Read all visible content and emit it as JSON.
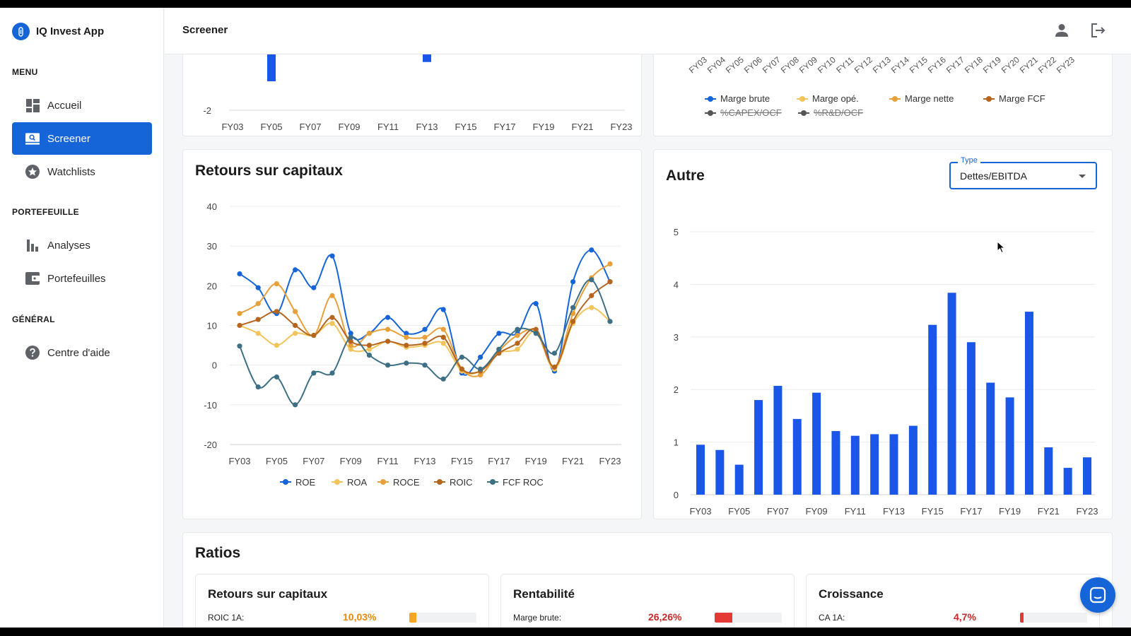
{
  "app": {
    "name": "IQ Invest App",
    "page_title": "Screener"
  },
  "sidebar": {
    "sections": [
      {
        "label": "MENU"
      },
      {
        "label": "PORTEFEUILLE"
      },
      {
        "label": "GÉNÉRAL"
      }
    ],
    "items": [
      {
        "label": "Accueil",
        "icon": "dashboard-icon"
      },
      {
        "label": "Screener",
        "icon": "screener-icon",
        "active": true
      },
      {
        "label": "Watchlists",
        "icon": "star-icon"
      },
      {
        "label": "Analyses",
        "icon": "bar-chart-icon"
      },
      {
        "label": "Portefeuilles",
        "icon": "wallet-icon"
      },
      {
        "label": "Centre d'aide",
        "icon": "help-icon"
      }
    ]
  },
  "cards": {
    "returns_title": "Retours sur capitaux",
    "other_title": "Autre",
    "ratios_title": "Ratios"
  },
  "type_select": {
    "label": "Type",
    "value": "Dettes/EBITDA"
  },
  "margins_legend": [
    {
      "name": "Marge brute",
      "color": "#1565d8",
      "hidden": false
    },
    {
      "name": "Marge opé.",
      "color": "#f2c45a",
      "hidden": false
    },
    {
      "name": "Marge nette",
      "color": "#e8a13a",
      "hidden": false
    },
    {
      "name": "Marge FCF",
      "color": "#b5651d",
      "hidden": false
    },
    {
      "name": "%CAPEX/OCF",
      "color": "#555555",
      "hidden": true
    },
    {
      "name": "%R&D/OCF",
      "color": "#555555",
      "hidden": true
    }
  ],
  "ratios": [
    {
      "title": "Retours sur capitaux",
      "label": "ROIC 1A:",
      "value": "10,03%",
      "value_color": "#e8890c",
      "fill": 0.1,
      "fill_color": "#f5a623"
    },
    {
      "title": "Rentabilité",
      "label": "Marge brute:",
      "value": "26,26%",
      "value_color": "#c62828",
      "fill": 0.26,
      "fill_color": "#e53935"
    },
    {
      "title": "Croissance",
      "label": "CA 1A:",
      "value": "4,7%",
      "value_color": "#c62828",
      "fill": 0.05,
      "fill_color": "#e53935"
    }
  ],
  "chart_data": [
    {
      "type": "bar",
      "title": "",
      "x": [
        "FY03",
        "FY04",
        "FY05",
        "FY06",
        "FY07",
        "FY08",
        "FY09",
        "FY10",
        "FY11",
        "FY12",
        "FY13",
        "FY14",
        "FY15",
        "FY16",
        "FY17",
        "FY18",
        "FY19",
        "FY20",
        "FY21",
        "FY22",
        "FY23"
      ],
      "x_tick_labels": [
        "FY03",
        "FY05",
        "FY07",
        "FY09",
        "FY11",
        "FY13",
        "FY15",
        "FY17",
        "FY19",
        "FY21",
        "FY23"
      ],
      "y_tick_labels": [
        "-2"
      ],
      "series": [
        {
          "values": [
            -0.2,
            -0.05,
            -1.1,
            -0.1,
            -0.1,
            0,
            0,
            0,
            0,
            0,
            -0.5,
            0,
            0,
            0,
            0,
            0,
            0,
            0,
            0,
            0,
            0
          ]
        }
      ]
    },
    {
      "type": "line",
      "title": "Retours sur capitaux",
      "x": [
        "FY03",
        "FY04",
        "FY05",
        "FY06",
        "FY07",
        "FY08",
        "FY09",
        "FY10",
        "FY11",
        "FY12",
        "FY13",
        "FY14",
        "FY15",
        "FY16",
        "FY17",
        "FY18",
        "FY19",
        "FY20",
        "FY21",
        "FY22",
        "FY23"
      ],
      "x_tick_labels": [
        "FY03",
        "FY05",
        "FY07",
        "FY09",
        "FY11",
        "FY13",
        "FY15",
        "FY17",
        "FY19",
        "FY21",
        "FY23"
      ],
      "ylim": [
        -20,
        40
      ],
      "y_ticks": [
        -20,
        -10,
        0,
        10,
        20,
        30,
        40
      ],
      "series": [
        {
          "name": "ROE",
          "color": "#1565d8",
          "values": [
            23,
            19.5,
            13,
            24,
            19.5,
            27.5,
            8,
            8,
            12,
            8,
            9,
            14,
            -2,
            2,
            8,
            8,
            15.5,
            -1.5,
            21,
            29,
            21
          ]
        },
        {
          "name": "ROA",
          "color": "#f2c45a",
          "values": [
            10,
            8,
            5,
            8,
            7.5,
            10.5,
            4,
            4,
            6,
            4.5,
            5,
            5.5,
            -1.5,
            -1.5,
            3,
            4,
            8.5,
            -1,
            10.5,
            14.5,
            11
          ]
        },
        {
          "name": "ROCE",
          "color": "#e8a13a",
          "values": [
            13,
            15.5,
            20.5,
            13.5,
            7.5,
            17.5,
            5,
            8,
            9,
            7,
            7,
            9,
            -1,
            -2.5,
            3.5,
            7.5,
            8.5,
            -0.5,
            13,
            22,
            25.5
          ]
        },
        {
          "name": "ROIC",
          "color": "#b5651d",
          "values": [
            10,
            11.5,
            13.5,
            10,
            7.5,
            12,
            6,
            5,
            6,
            5,
            5.5,
            7,
            -1,
            -1.5,
            3,
            5.5,
            9,
            -0.5,
            11,
            17.5,
            21
          ]
        },
        {
          "name": "FCF ROC",
          "color": "#3d6f85",
          "values": [
            4.8,
            -5.5,
            -3,
            -10,
            -2,
            -2,
            7,
            2.5,
            0,
            0.5,
            0,
            -3.5,
            2,
            -1,
            4,
            9,
            8,
            3,
            14.5,
            21.5,
            11
          ]
        }
      ]
    },
    {
      "type": "bar",
      "title": "Autre",
      "x": [
        "FY03",
        "FY04",
        "FY05",
        "FY06",
        "FY07",
        "FY08",
        "FY09",
        "FY10",
        "FY11",
        "FY12",
        "FY13",
        "FY14",
        "FY15",
        "FY16",
        "FY17",
        "FY18",
        "FY19",
        "FY20",
        "FY21",
        "FY22",
        "FY23"
      ],
      "x_tick_labels": [
        "FY03",
        "FY05",
        "FY07",
        "FY09",
        "FY11",
        "FY13",
        "FY15",
        "FY17",
        "FY19",
        "FY21",
        "FY23"
      ],
      "ylim": [
        0,
        5
      ],
      "y_ticks": [
        0,
        1,
        2,
        3,
        4,
        5
      ],
      "series": [
        {
          "name": "Dettes/EBITDA",
          "color": "#1a56e8",
          "values": [
            0.95,
            0.85,
            0.57,
            1.8,
            2.07,
            1.44,
            1.94,
            1.21,
            1.12,
            1.15,
            1.15,
            1.31,
            3.23,
            3.84,
            2.9,
            2.13,
            1.85,
            3.48,
            0.9,
            0.51,
            0.71
          ]
        }
      ]
    }
  ]
}
